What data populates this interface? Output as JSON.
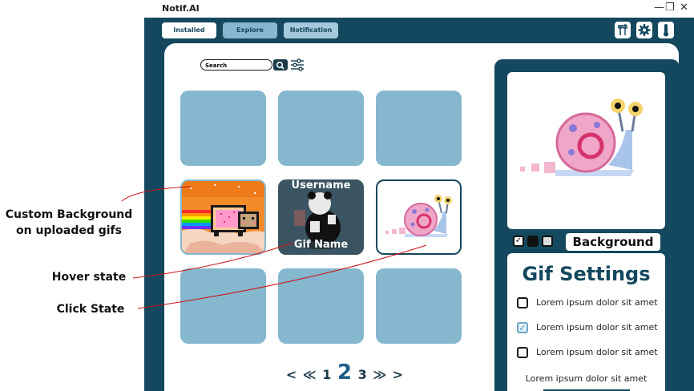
{
  "annotations": {
    "custom_background": "Custom Background\non uploaded gifs",
    "hover_state": "Hover state",
    "click_state": "Click State"
  },
  "app": {
    "title": "Notif.AI",
    "window_controls": {
      "minimize": "—",
      "restore": "❐",
      "close": "✕"
    }
  },
  "nav": {
    "tabs": [
      {
        "label": "Installed"
      },
      {
        "label": "Explore"
      },
      {
        "label": "Notification"
      }
    ],
    "icons": [
      "tools-icon",
      "gear-icon",
      "thermometer-icon"
    ]
  },
  "search": {
    "placeholder": "Search"
  },
  "grid": {
    "hover_tile": {
      "title": "Username",
      "name": "Gif Name"
    }
  },
  "pagination": {
    "prev": "<",
    "first": "≪",
    "pages": [
      "1",
      "2",
      "3"
    ],
    "current": "2",
    "last": "≫",
    "next": ">"
  },
  "sidebar": {
    "background_label": "Background",
    "settings_title": "Gif Settings",
    "options": [
      {
        "label": "Lorem ipsum dolor sit amet",
        "checked": false
      },
      {
        "label": "Lorem ipsum dolor sit amet",
        "checked": true
      },
      {
        "label": "Lorem ipsum dolor sit amet",
        "checked": false
      }
    ],
    "plain_text": "Lorem ipsum dolor sit amet"
  },
  "colors": {
    "primary": "#14485e",
    "tile": "#85b8cf",
    "explore_tab": "#85b8cf",
    "notification_tab": "#a5c9dc",
    "annotation_line": "#cc1111"
  }
}
